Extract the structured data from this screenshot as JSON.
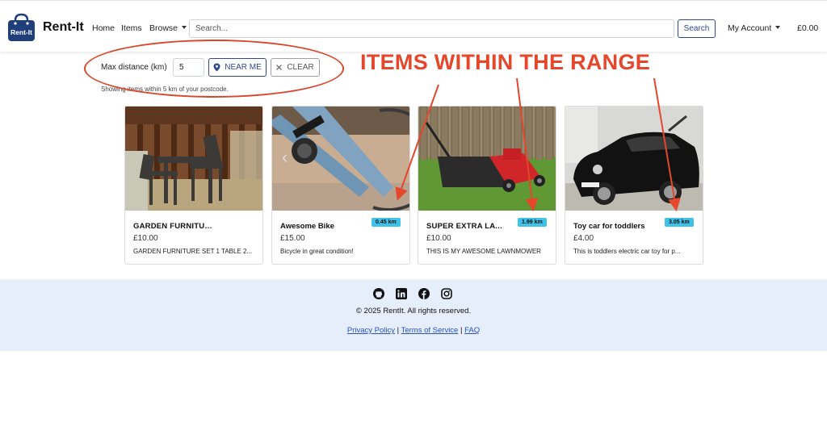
{
  "nav": {
    "brand": "Rent-It",
    "logo_text": "Rent-It",
    "home": "Home",
    "items": "Items",
    "browse": "Browse",
    "search_placeholder": "Search...",
    "search_button": "Search",
    "account": "My Account",
    "cart_total": "£0.00"
  },
  "filter": {
    "label": "Max distance (km)",
    "value": "5",
    "near_me": "NEAR ME",
    "clear": "CLEAR",
    "note": "Showing items within 5 km of your postcode."
  },
  "annotation": "ITEMS WITHIN THE RANGE",
  "items": [
    {
      "title": "GARDEN FURNITURE SET",
      "price": "£10.00",
      "description": "GARDEN FURNITURE SET 1 TABLE 2...",
      "distance": ""
    },
    {
      "title": "Awesome Bike",
      "price": "£15.00",
      "description": "Bicycle in great condition!",
      "distance": "0.45 km"
    },
    {
      "title": "SUPER EXTRA LAWN ...",
      "price": "£10.00",
      "description": "THIS IS MY AWESOME LAWNMOWER",
      "distance": "1.99 km"
    },
    {
      "title": "Toy car for toddlers",
      "price": "£4.00",
      "description": "This is toddlers electric car toy for p...",
      "distance": "3.05 km"
    }
  ],
  "footer": {
    "copyright": "© 2025 RentIt. All rights reserved.",
    "privacy": "Privacy Policy",
    "terms": "Terms of Service",
    "faq": "FAQ",
    "separator": "|",
    "icons": [
      "github-icon",
      "linkedin-icon",
      "facebook-icon",
      "instagram-icon"
    ]
  },
  "colors": {
    "accent": "#2e4a8a",
    "badge": "#3ec2e8",
    "annotation": "#e4472b",
    "footer_bg": "#e6edfb",
    "link": "#2752c9"
  }
}
